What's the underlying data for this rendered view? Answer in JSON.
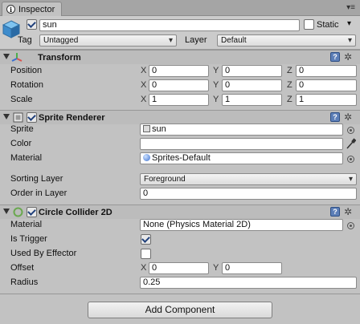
{
  "window": {
    "tab_title": "Inspector",
    "tab_icon_glyph": "i",
    "menu_glyph": "▾≡"
  },
  "header": {
    "object_name": "sun",
    "active_checked": true,
    "static_label": "Static",
    "static_checked": false,
    "tag_label": "Tag",
    "tag_value": "Untagged",
    "layer_label": "Layer",
    "layer_value": "Default"
  },
  "transform": {
    "title": "Transform",
    "rows": [
      {
        "label": "Position",
        "x": "0",
        "y": "0",
        "z": "0"
      },
      {
        "label": "Rotation",
        "x": "0",
        "y": "0",
        "z": "0"
      },
      {
        "label": "Scale",
        "x": "1",
        "y": "1",
        "z": "1"
      }
    ],
    "axis_labels": {
      "x": "X",
      "y": "Y",
      "z": "Z"
    }
  },
  "sprite_renderer": {
    "title": "Sprite Renderer",
    "enabled": true,
    "sprite_label": "Sprite",
    "sprite_value": "sun",
    "color_label": "Color",
    "color_value": "#ffffff",
    "material_label": "Material",
    "material_value": "Sprites-Default",
    "sorting_layer_label": "Sorting Layer",
    "sorting_layer_value": "Foreground",
    "order_label": "Order in Layer",
    "order_value": "0"
  },
  "circle_collider": {
    "title": "Circle Collider 2D",
    "enabled": true,
    "material_label": "Material",
    "material_value": "None (Physics Material 2D)",
    "is_trigger_label": "Is Trigger",
    "is_trigger": true,
    "used_by_effector_label": "Used By Effector",
    "used_by_effector": false,
    "offset_label": "Offset",
    "offset_x": "0",
    "offset_y": "0",
    "radius_label": "Radius",
    "radius_value": "0.25"
  },
  "add_component_label": "Add Component",
  "colors": {
    "panel_bg": "#c2c2c2",
    "help_blue": "#5d7fb8",
    "collider_green": "#6aa84f"
  }
}
